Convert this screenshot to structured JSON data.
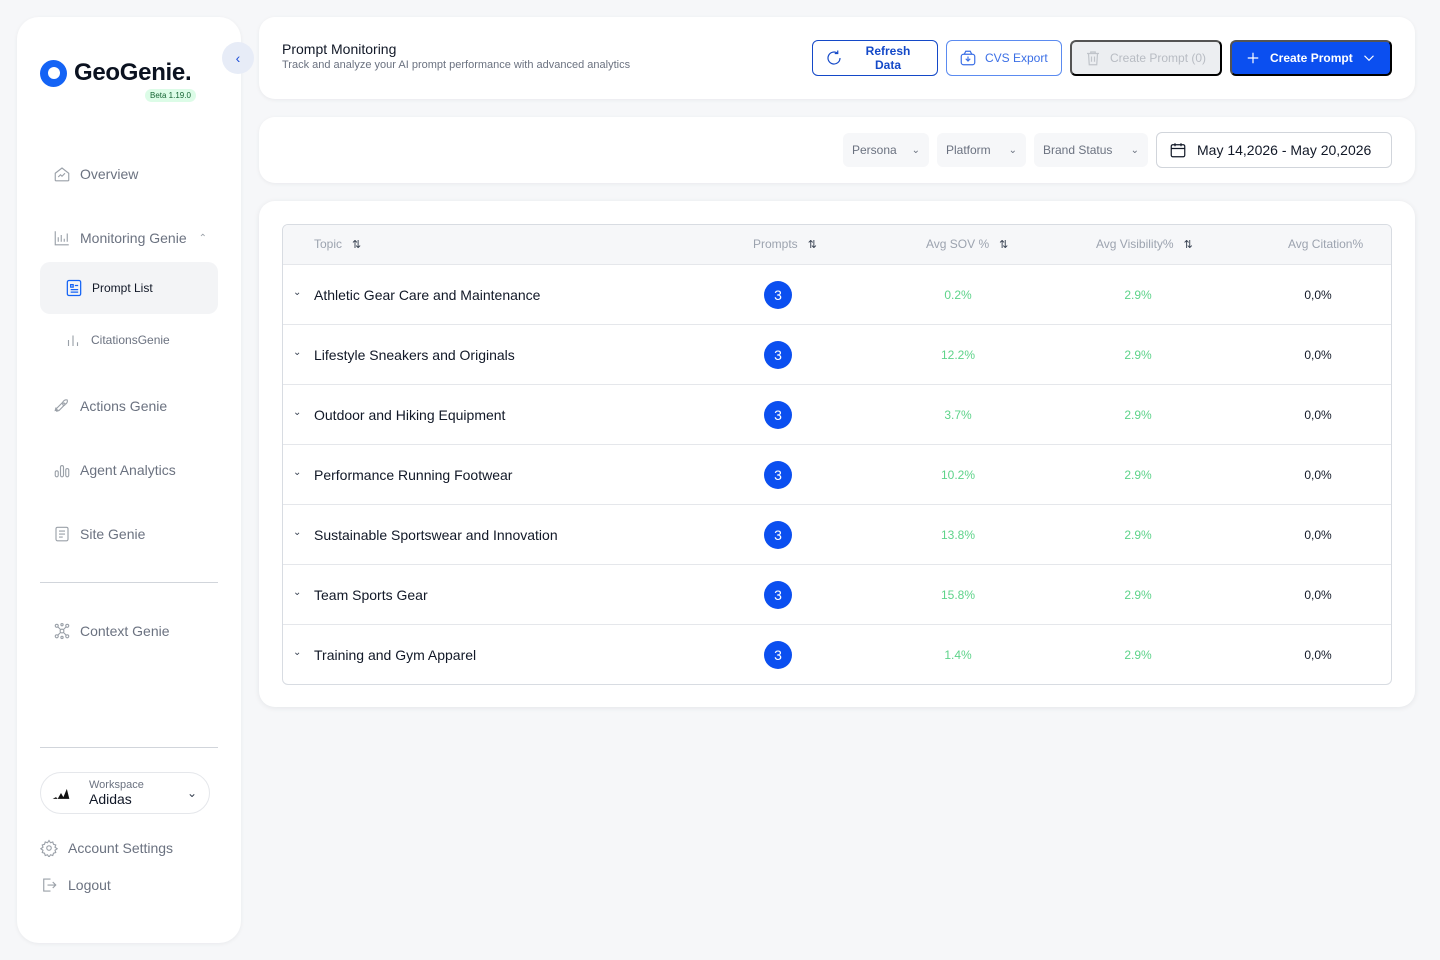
{
  "brand": {
    "name": "GeoGenie.",
    "version": "Beta 1.19.0"
  },
  "sidebar": {
    "items": [
      {
        "label": "Overview",
        "icon": "home-icon"
      },
      {
        "label": "Monitoring Genie",
        "icon": "chart-icon"
      },
      {
        "label": "Prompt List",
        "icon": "document-icon"
      },
      {
        "label": "CitationsGenie",
        "icon": "bar-chart-icon"
      },
      {
        "label": "Actions Genie",
        "icon": "rocket-icon"
      },
      {
        "label": "Agent Analytics",
        "icon": "analytics-icon"
      },
      {
        "label": "Site Genie",
        "icon": "file-icon"
      },
      {
        "label": "Context Genie",
        "icon": "network-icon"
      }
    ],
    "workspace": {
      "label": "Workspace",
      "name": "Adidas"
    },
    "account_settings": "Account Settings",
    "logout": "Logout"
  },
  "header": {
    "title": "Prompt Monitoring",
    "subtitle": "Track and analyze your AI prompt performance with advanced analytics",
    "refresh_label": "Refresh Data",
    "export_label": "CVS Export",
    "create_disabled_label": "Create Prompt (0)",
    "create_label": "Create Prompt"
  },
  "filters": {
    "persona": "Persona",
    "platform": "Platform",
    "brand_status": "Brand Status",
    "date_range": "May 14,2026 - May 20,2026"
  },
  "table": {
    "columns": [
      "Topic",
      "Prompts",
      "Avg SOV %",
      "Avg Visibility%",
      "Avg Citation%"
    ],
    "rows": [
      {
        "topic": "Athletic Gear Care and Maintenance",
        "prompts": "3",
        "sov": "0.2%",
        "visibility": "2.9%",
        "citation": "0,0%"
      },
      {
        "topic": "Lifestyle Sneakers and Originals",
        "prompts": "3",
        "sov": "12.2%",
        "visibility": "2.9%",
        "citation": "0,0%"
      },
      {
        "topic": "Outdoor and Hiking Equipment",
        "prompts": "3",
        "sov": "3.7%",
        "visibility": "2.9%",
        "citation": "0,0%"
      },
      {
        "topic": "Performance Running Footwear",
        "prompts": "3",
        "sov": "10.2%",
        "visibility": "2.9%",
        "citation": "0,0%"
      },
      {
        "topic": "Sustainable Sportswear and Innovation",
        "prompts": "3",
        "sov": "13.8%",
        "visibility": "2.9%",
        "citation": "0,0%"
      },
      {
        "topic": "Team Sports Gear",
        "prompts": "3",
        "sov": "15.8%",
        "visibility": "2.9%",
        "citation": "0,0%"
      },
      {
        "topic": "Training and Gym Apparel",
        "prompts": "3",
        "sov": "1.4%",
        "visibility": "2.9%",
        "citation": "0,0%"
      }
    ]
  },
  "colors": {
    "primary": "#0b4ff0",
    "positive": "#5ed38a"
  }
}
